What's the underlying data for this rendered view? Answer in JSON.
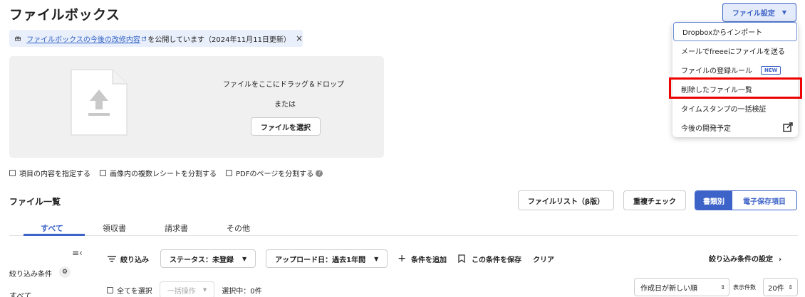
{
  "page": {
    "title": "ファイルボックス"
  },
  "notice": {
    "link_text": "ファイルボックスの今後の改修内容",
    "suffix": "を公開しています（2024年11月11日更新）",
    "close": "×"
  },
  "dropzone": {
    "line1": "ファイルをここにドラッグ＆ドロップ",
    "line2": "または",
    "select_button": "ファイルを選択"
  },
  "options": [
    {
      "label": "項目の内容を指定する",
      "checked": false
    },
    {
      "label": "画像内の複数レシートを分割する",
      "checked": false
    },
    {
      "label": "PDFのページを分割する",
      "checked": false
    }
  ],
  "file_list": {
    "title": "ファイル一覧",
    "file_list_beta": "ファイルリスト（β版）",
    "dup_check": "重複チェック",
    "view_by_doc": "書類別",
    "view_by_storage": "電子保存項目"
  },
  "tabs": [
    "すべて",
    "領収書",
    "請求書",
    "その他"
  ],
  "active_tab": 0,
  "sidebar": {
    "filter_conditions": "絞り込み条件",
    "all": "すべて"
  },
  "filterbar": {
    "narrow": "絞り込み",
    "status": "ステータス：未登録",
    "upload_date": "アップロード日：過去1年間",
    "add_condition": "条件を追加",
    "save_condition": "この条件を保存",
    "clear": "クリア",
    "settings": "絞り込み条件の設定"
  },
  "selection": {
    "select_all": "全てを選択",
    "bulk": "一括操作",
    "selected": "選択中：0件"
  },
  "sort": {
    "value": "作成日が新しい順"
  },
  "perpage": {
    "label": "表示件数",
    "value": "20件"
  },
  "settings_menu": {
    "button": "ファイル設定",
    "items": [
      "Dropboxからインポート",
      "メールでfreeeにファイルを送る",
      "ファイルの登録ルール",
      "削除したファイル一覧",
      "タイムスタンプの一括検証",
      "今後の開発予定"
    ],
    "new_badge": "NEW",
    "highlighted_index": 3
  },
  "colors": {
    "accent": "#3e63c8",
    "highlight": "#ee0000",
    "notice_bg": "#eaf0fb"
  }
}
